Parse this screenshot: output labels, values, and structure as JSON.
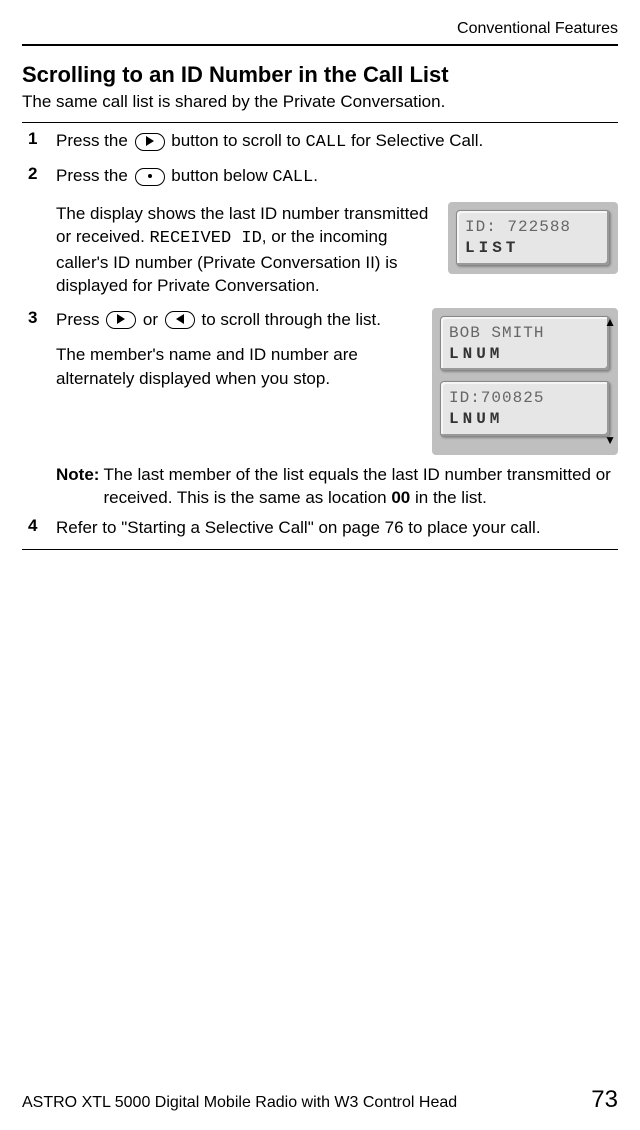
{
  "header": {
    "right": "Conventional Features"
  },
  "title": "Scrolling to an ID Number in the Call List",
  "intro": "The same call list is shared by the Private Conversation.",
  "steps": {
    "s1": {
      "num": "1",
      "pre": "Press the ",
      "mid": " button to scroll to ",
      "mono": "CALL",
      "post": " for Selective Call."
    },
    "s2": {
      "num": "2",
      "pre": "Press the ",
      "mid": " button below ",
      "mono": "CALL",
      "post": ".",
      "para2a": "The display shows the last ID number transmitted or received. ",
      "para2_mono": "RECEIVED ID",
      "para2b": ", or the incoming caller's ID number (Private Conversation II) is displayed for Private Conversation.",
      "lcd1_line1": "ID: 722588",
      "lcd1_line2": "LIST"
    },
    "s3": {
      "num": "3",
      "pre": "Press ",
      "or": " or ",
      "post": " to scroll through the list.",
      "para2": "The member's name and ID number are alternately displayed when you stop.",
      "lcdA_line1": "BOB SMITH",
      "lcdA_line2": "LNUM",
      "lcdB_line1": "ID:700825",
      "lcdB_line2": "LNUM",
      "note_label": "Note:",
      "note_text": "The last member of the list equals the last ID number transmitted or received. This is the same as location ",
      "note_bold": "00",
      "note_text2": " in the list."
    },
    "s4": {
      "num": "4",
      "text": "Refer to \"Starting a Selective Call\" on page 76 to place your call."
    }
  },
  "footer": {
    "left": "ASTRO XTL 5000 Digital Mobile Radio with W3 Control Head",
    "page": "73"
  }
}
